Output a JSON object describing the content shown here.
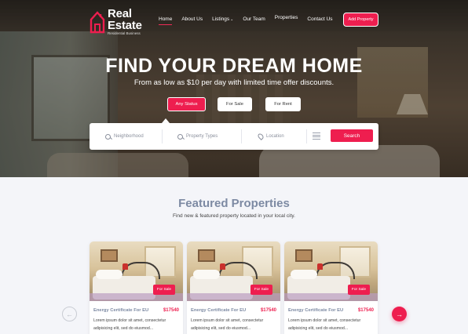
{
  "brand": {
    "name_line1": "Real",
    "name_line2": "Estate",
    "tagline": "Residential Business",
    "accent_color": "#ee1e4f"
  },
  "nav": {
    "items": [
      {
        "label": "Home",
        "active": true
      },
      {
        "label": "About Us"
      },
      {
        "label": "Listings",
        "has_dropdown": true
      },
      {
        "label": "Our Team"
      },
      {
        "label": "Properties"
      },
      {
        "label": "Contact Us"
      }
    ],
    "add_property_label": "Add Property"
  },
  "hero": {
    "title": "FIND YOUR DREAM HOME",
    "subtitle": "From as low as $10 per day with limited time offer discounts.",
    "status_tabs": [
      {
        "label": "Any Status",
        "active": true
      },
      {
        "label": "For Sale"
      },
      {
        "label": "For Rent"
      }
    ]
  },
  "search": {
    "neighborhood_placeholder": "Neighborhood",
    "property_types_placeholder": "Property Types",
    "location_placeholder": "Location",
    "button_label": "Search",
    "icons": [
      "search-icon",
      "search-icon",
      "location-pin-icon",
      "filter-icon"
    ]
  },
  "featured": {
    "title": "Featured Properties",
    "subtitle": "Find new & featured property located in your local city.",
    "cards": [
      {
        "badge": "For Sale",
        "title": "Energy Certificate For EU",
        "price": "$17540",
        "desc_line1": "Lorem ipsum dolor sit amet, consectetur",
        "desc_line2": "adipisicing elit, sed do eiusmod..."
      },
      {
        "badge": "For Sale",
        "title": "Energy Certificate For EU",
        "price": "$17540",
        "desc_line1": "Lorem ipsum dolor sit amet, consectetur",
        "desc_line2": "adipisicing elit, sed do eiusmod..."
      },
      {
        "badge": "For Sale",
        "title": "Energy Certificate For EU",
        "price": "$17540",
        "desc_line1": "Lorem ipsum dolor sit amet, consectetur",
        "desc_line2": "adipisicing elit, sed do eiusmod..."
      }
    ],
    "prev_icon": "arrow-left-icon",
    "next_icon": "arrow-right-icon"
  }
}
